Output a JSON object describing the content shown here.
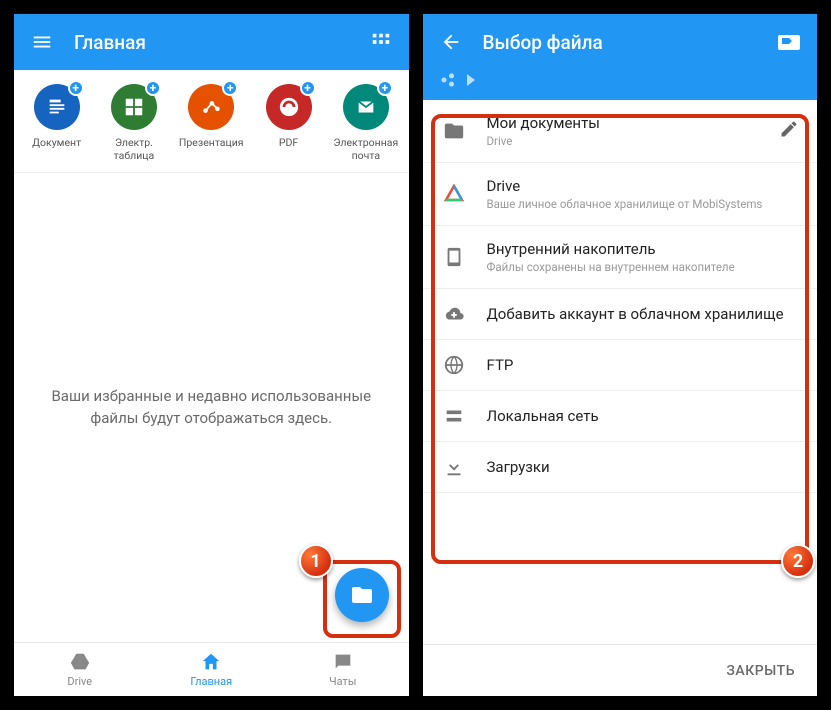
{
  "screen1": {
    "title": "Главная",
    "shortcuts": [
      {
        "label": "Документ",
        "color": "#1565c0"
      },
      {
        "label": "Электр.\nтаблица",
        "color": "#2e7d32"
      },
      {
        "label": "Презентация",
        "color": "#e65100"
      },
      {
        "label": "PDF",
        "color": "#c62828"
      },
      {
        "label": "Электронная\nпочта",
        "color": "#00897b"
      }
    ],
    "empty_message": "Ваши избранные и недавно использованные файлы будут отображаться здесь.",
    "bottom_nav": [
      {
        "label": "Drive"
      },
      {
        "label": "Главная"
      },
      {
        "label": "Чаты"
      }
    ]
  },
  "screen2": {
    "title": "Выбор файла",
    "items": [
      {
        "title": "Мои документы",
        "sub": "Drive",
        "kind": "folder",
        "editable": true
      },
      {
        "title": "Drive",
        "sub": "Ваше личное облачное хранилище от MobiSystems",
        "kind": "drive"
      },
      {
        "title": "Внутренний накопитель",
        "sub": "Файлы сохранены на внутреннем накопителе",
        "kind": "phone"
      },
      {
        "title": "Добавить аккаунт в облачном хранилище",
        "kind": "cloud-add"
      },
      {
        "title": "FTP",
        "kind": "ftp"
      },
      {
        "title": "Локальная сеть",
        "kind": "lan"
      },
      {
        "title": "Загрузки",
        "kind": "download"
      }
    ],
    "close_label": "ЗАКРЫТЬ"
  },
  "callouts": {
    "one": "1",
    "two": "2"
  }
}
